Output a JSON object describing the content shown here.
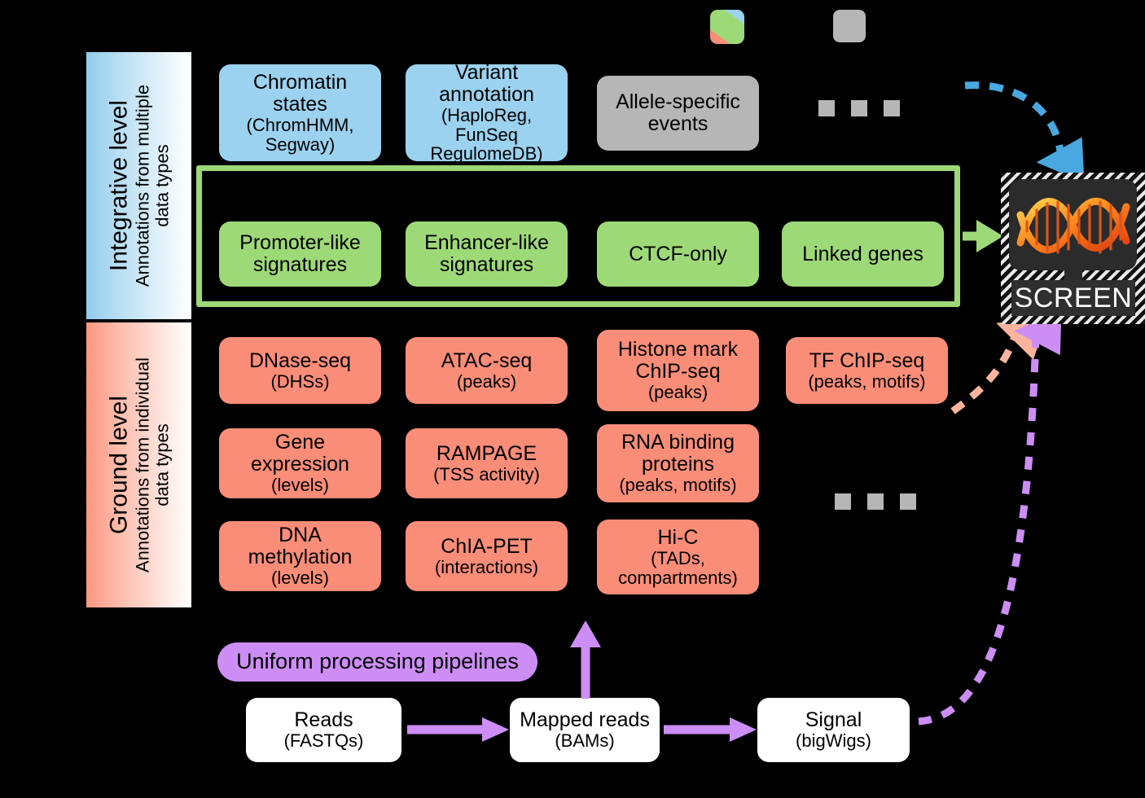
{
  "levels": {
    "integrative": {
      "title": "Integrative level",
      "subtitle": "Annotations from multiple\ndata types",
      "subtitle_line1": "Annotations from multiple",
      "subtitle_line2": "data types",
      "color": "#93ccec"
    },
    "ground": {
      "title": "Ground level",
      "subtitle_line1": "Annotations from individual",
      "subtitle_line2": "data types",
      "color": "#fb9781"
    }
  },
  "integrative_row": [
    {
      "id": "chromatin-states",
      "color": "#9bd2ef",
      "lines": [
        "Chromatin",
        "states"
      ],
      "sublines": [
        "(ChromHMM,",
        "Segway)"
      ]
    },
    {
      "id": "variant-annotation",
      "color": "#9bd2ef",
      "lines": [
        "Variant",
        "annotation"
      ],
      "sublines": [
        "(HaploReg, FunSeq",
        "RegulomeDB)"
      ]
    },
    {
      "id": "allele-specific-events",
      "color": "#b6b6b6",
      "lines": [
        "Allele-specific",
        "events"
      ],
      "sublines": []
    }
  ],
  "registry_row": [
    {
      "id": "promoter-like-signatures",
      "color": "#9ed977",
      "lines": [
        "Promoter-like",
        "signatures"
      ],
      "sublines": []
    },
    {
      "id": "enhancer-like-signatures",
      "color": "#9ed977",
      "lines": [
        "Enhancer-like",
        "signatures"
      ],
      "sublines": []
    },
    {
      "id": "ctcf-only",
      "color": "#9ed977",
      "lines": [
        "CTCF-only"
      ],
      "sublines": []
    },
    {
      "id": "linked-genes",
      "color": "#9ed977",
      "lines": [
        "Linked genes"
      ],
      "sublines": []
    }
  ],
  "ground_rows": [
    [
      {
        "id": "dnase-seq",
        "color": "#fa8d78",
        "lines": [
          "DNase-seq"
        ],
        "sublines": [
          "(DHSs)"
        ]
      },
      {
        "id": "atac-seq",
        "color": "#fa8d78",
        "lines": [
          "ATAC-seq"
        ],
        "sublines": [
          "(peaks)"
        ]
      },
      {
        "id": "histone-mark-chip-seq",
        "color": "#fa8d78",
        "lines": [
          "Histone mark",
          "ChIP-seq"
        ],
        "sublines": [
          "(peaks)"
        ]
      },
      {
        "id": "tf-chip-seq",
        "color": "#fa8d78",
        "lines": [
          "TF ChIP-seq"
        ],
        "sublines": [
          "(peaks, motifs)"
        ]
      }
    ],
    [
      {
        "id": "gene-expression",
        "color": "#fa8d78",
        "lines": [
          "Gene",
          "expression"
        ],
        "sublines": [
          "(levels)"
        ]
      },
      {
        "id": "rampage",
        "color": "#fa8d78",
        "lines": [
          "RAMPAGE"
        ],
        "sublines": [
          "(TSS activity)"
        ]
      },
      {
        "id": "rna-binding-proteins",
        "color": "#fa8d78",
        "lines": [
          "RNA binding",
          "proteins"
        ],
        "sublines": [
          "(peaks, motifs)"
        ]
      }
    ],
    [
      {
        "id": "dna-methylation",
        "color": "#fa8d78",
        "lines": [
          "DNA",
          "methylation"
        ],
        "sublines": [
          "(levels)"
        ]
      },
      {
        "id": "chia-pet",
        "color": "#fa8d78",
        "lines": [
          "ChIA-PET"
        ],
        "sublines": [
          "(interactions)"
        ]
      },
      {
        "id": "hi-c",
        "color": "#fa8d78",
        "lines": [
          "Hi-C"
        ],
        "sublines": [
          "(TADs,",
          "compartments)"
        ]
      }
    ]
  ],
  "pipeline": {
    "label": "Uniform processing pipelines",
    "label_color": "#cc8ef5",
    "steps": [
      {
        "id": "reads",
        "lines": [
          "Reads"
        ],
        "sublines": [
          "(FASTQs)"
        ]
      },
      {
        "id": "mapped-reads",
        "lines": [
          "Mapped reads"
        ],
        "sublines": [
          "(BAMs)"
        ]
      },
      {
        "id": "signal",
        "lines": [
          "Signal"
        ],
        "sublines": [
          "(bigWigs)"
        ]
      }
    ]
  },
  "screen": {
    "label": "SCREEN"
  },
  "legend": {
    "tri_colors": [
      "#9bd2ef",
      "#9ed977",
      "#fa8d78"
    ],
    "gray_color": "#b6b6b6"
  },
  "arrow_colors": {
    "blue": "#4aa8e0",
    "green": "#9ed977",
    "salmon": "#fcb49c",
    "purple": "#cc8ef5"
  },
  "ellipsis_color": "#b6b6b6"
}
